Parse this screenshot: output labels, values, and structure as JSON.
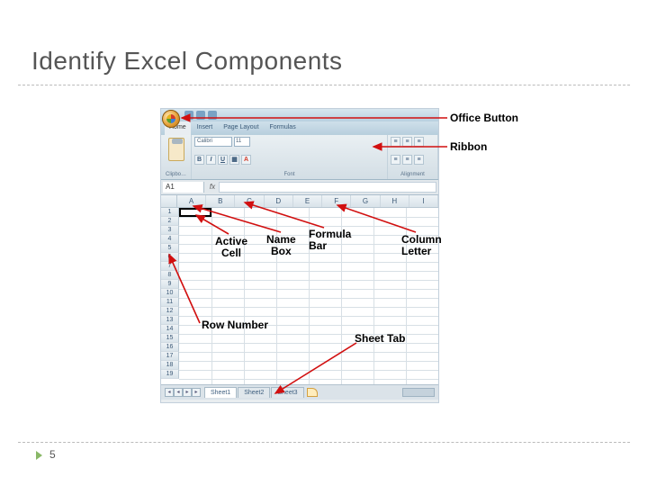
{
  "slide": {
    "title": "Identify Excel Components",
    "page_number": "5"
  },
  "callouts": {
    "office_button": "Office Button",
    "ribbon": "Ribbon",
    "name_box": "Name\nBox",
    "formula_bar": "Formula\nBar",
    "column_letter": "Column\nLetter",
    "active_cell": "Active\nCell",
    "row_number": "Row Number",
    "sheet_tab": "Sheet Tab"
  },
  "excel": {
    "tabs": {
      "home": "Home",
      "insert": "Insert",
      "page_layout": "Page Layout",
      "formulas": "Formulas"
    },
    "groups": {
      "clipboard": "Clipbo…",
      "font": "Font",
      "alignment": "Alignment"
    },
    "font_name": "Calibri",
    "font_size": "11",
    "name_box_value": "A1",
    "fx": "fx",
    "columns": [
      "A",
      "B",
      "C",
      "D",
      "E",
      "F",
      "G",
      "H",
      "I"
    ],
    "row_count": 19,
    "sheets": {
      "s1": "Sheet1",
      "s2": "Sheet2",
      "s3": "Sheet3"
    }
  }
}
